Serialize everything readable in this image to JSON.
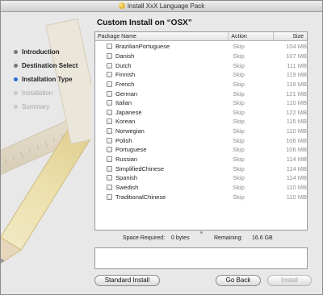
{
  "window": {
    "title": "Install XxX Language Pack"
  },
  "sidebar": {
    "steps": [
      {
        "label": "Introduction",
        "state": "done"
      },
      {
        "label": "Destination Select",
        "state": "done"
      },
      {
        "label": "Installation Type",
        "state": "current"
      },
      {
        "label": "Installation",
        "state": "future"
      },
      {
        "label": "Summary",
        "state": "future"
      }
    ]
  },
  "main": {
    "heading": "Custom Install on “OSX”",
    "columns": {
      "name": "Package Name",
      "action": "Action",
      "size": "Size"
    },
    "packages": [
      {
        "name": "BrazilianPortuguese",
        "action": "Skip",
        "size": "104 MB"
      },
      {
        "name": "Danish",
        "action": "Skip",
        "size": "107 MB"
      },
      {
        "name": "Dutch",
        "action": "Skip",
        "size": "111 MB"
      },
      {
        "name": "Finnish",
        "action": "Skip",
        "size": "119 MB"
      },
      {
        "name": "French",
        "action": "Skip",
        "size": "119 MB"
      },
      {
        "name": "German",
        "action": "Skip",
        "size": "121 MB"
      },
      {
        "name": "Italian",
        "action": "Skip",
        "size": "110 MB"
      },
      {
        "name": "Japanese",
        "action": "Skip",
        "size": "122 MB"
      },
      {
        "name": "Korean",
        "action": "Skip",
        "size": "115 MB"
      },
      {
        "name": "Norwegian",
        "action": "Skip",
        "size": "110 MB"
      },
      {
        "name": "Polish",
        "action": "Skip",
        "size": "106 MB"
      },
      {
        "name": "Portuguese",
        "action": "Skip",
        "size": "106 MB"
      },
      {
        "name": "Russian",
        "action": "Skip",
        "size": "114 MB"
      },
      {
        "name": "SimplifiedChinese",
        "action": "Skip",
        "size": "114 MB"
      },
      {
        "name": "Spanish",
        "action": "Skip",
        "size": "114 MB"
      },
      {
        "name": "Swedish",
        "action": "Skip",
        "size": "110 MB"
      },
      {
        "name": "TraditionalChinese",
        "action": "Skip",
        "size": "110 MB"
      }
    ],
    "space_required_label": "Space Required:",
    "space_required_value": "0 bytes",
    "remaining_label": "Remaining:",
    "remaining_value": "16.6 GB"
  },
  "buttons": {
    "standard_install": "Standard Install",
    "go_back": "Go Back",
    "install": "Install"
  },
  "icons": {
    "title": "installer-package-icon",
    "art": "pencil-ruler-icon"
  }
}
